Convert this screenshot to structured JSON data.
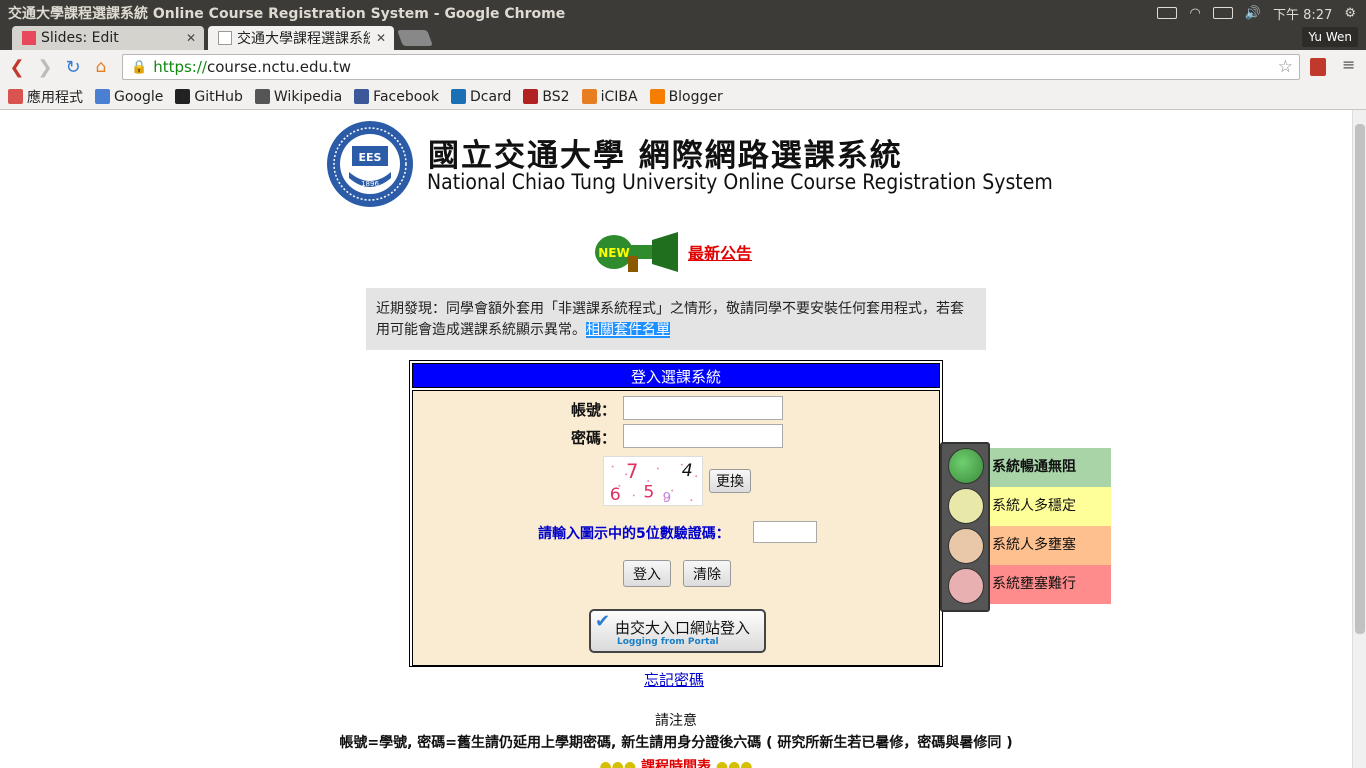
{
  "window": {
    "title": "交通大學課程選課系統 Online Course Registration System - Google Chrome",
    "clock": "下午 8:27",
    "user": "Yu Wen"
  },
  "tabs": [
    {
      "label": "Slides: Edit",
      "favicon_color": "#e8485b"
    },
    {
      "label": "交通大學課程選課系統",
      "favicon_color": "#ffffff"
    }
  ],
  "address": {
    "scheme": "https://",
    "host": "course.nctu.edu.tw"
  },
  "bookmarks": [
    {
      "label": "應用程式",
      "icon": "apps-grid-icon",
      "color": "#d9534f"
    },
    {
      "label": "Google",
      "icon": "google-icon",
      "color": "#4a7fd4"
    },
    {
      "label": "GitHub",
      "icon": "github-icon",
      "color": "#222222"
    },
    {
      "label": "Wikipedia",
      "icon": "wikipedia-icon",
      "color": "#555555"
    },
    {
      "label": "Facebook",
      "icon": "facebook-icon",
      "color": "#3b5998"
    },
    {
      "label": "Dcard",
      "icon": "dcard-icon",
      "color": "#1a6fb5"
    },
    {
      "label": "BS2",
      "icon": "bs2-icon",
      "color": "#b22222"
    },
    {
      "label": "iCIBA",
      "icon": "iciba-icon",
      "color": "#e67e22"
    },
    {
      "label": "Blogger",
      "icon": "blogger-icon",
      "color": "#f57d00"
    }
  ],
  "page": {
    "title_zh": "國立交通大學 網際網路選課系統",
    "title_en": "National Chiao Tung University Online Course Registration System",
    "logo_year": "1896",
    "news_link": "最新公告",
    "news_badge": "NEW",
    "notice_text": "近期發現：同學會額外套用「非選課系統程式」之情形，敬請同學不要安裝任何套用程式，若套用可能會造成選課系統顯示異常。",
    "notice_link": "相關套件名單",
    "login": {
      "header": "登入選課系統",
      "account_label": "帳號：",
      "password_label": "密碼：",
      "account_value": "",
      "password_value": "",
      "captcha_refresh": "更換",
      "verify_label": "請輸入圖示中的5位數驗證碼：",
      "verify_value": "",
      "submit": "登入",
      "clear": "清除",
      "portal_zh": "由交大入口網站登入",
      "portal_en": "Logging from Portal"
    },
    "forgot": "忘記密碼",
    "note_title": "請注意",
    "note_text": "帳號=學號, 密碼=舊生請仍延用上學期密碼, 新生請用身分證後六碼 ( 研究所新生若已暑修，密碼與暑修同 )",
    "schedule_label": "課程時間表",
    "traffic": [
      {
        "label": "系統暢通無阻",
        "light": "#3a8a3a",
        "bg": "#a8d4a8",
        "active": true
      },
      {
        "label": "系統人多穩定",
        "light": "#e8e8a8",
        "bg": "#ffff99",
        "active": false
      },
      {
        "label": "系統人多壅塞",
        "light": "#e8c8a8",
        "bg": "#ffc090",
        "active": false
      },
      {
        "label": "系統壅塞難行",
        "light": "#e8b0b0",
        "bg": "#ff8c8c",
        "active": false
      }
    ]
  }
}
